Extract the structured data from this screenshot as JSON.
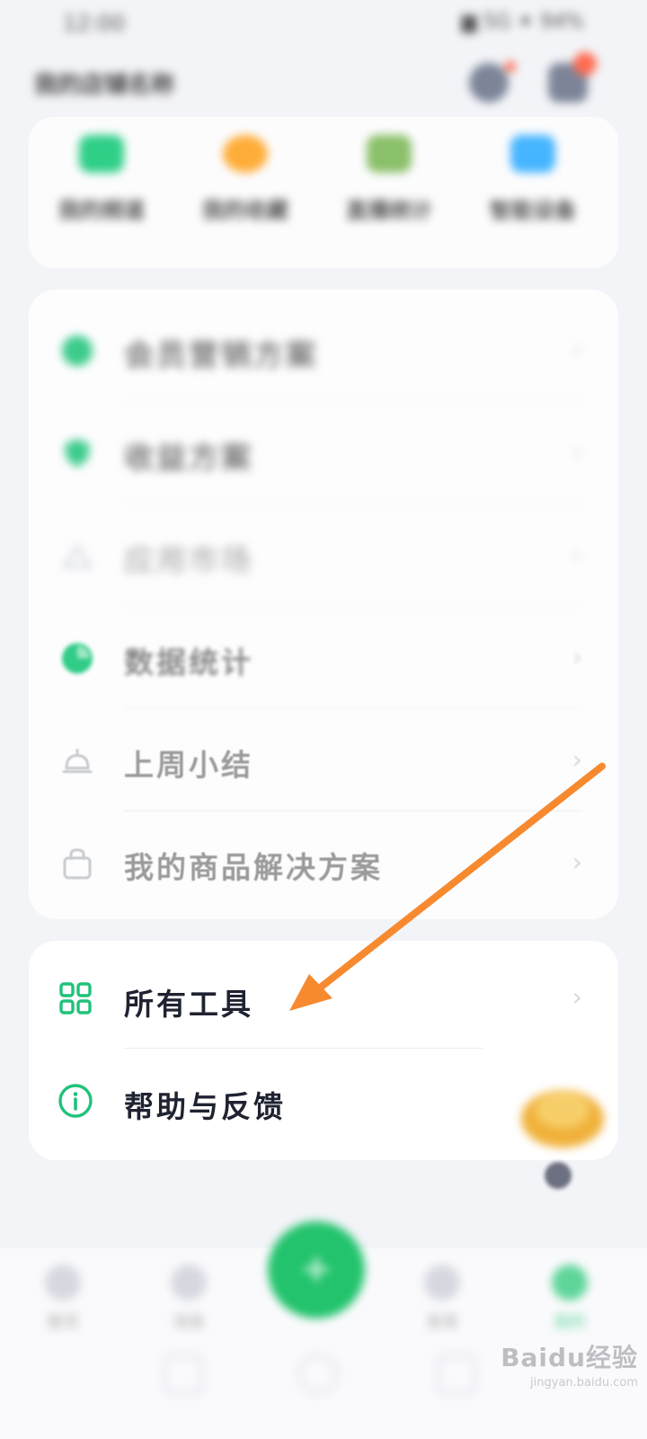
{
  "status_bar": {
    "time": "12:00",
    "right": "▆ 5G ✦ 94%"
  },
  "header": {
    "title": "我的店铺名称"
  },
  "quick_actions": [
    {
      "label": "我的频道",
      "color": "#2fcf88"
    },
    {
      "label": "我的收藏",
      "color": "#ffad39"
    },
    {
      "label": "直播统计",
      "color": "#8ac06a"
    },
    {
      "label": "智能设备",
      "color": "#46b5ff"
    }
  ],
  "menu": {
    "items": [
      {
        "label": "会员营销方案",
        "icon": "leaf-icon",
        "color": "#3ccb8b"
      },
      {
        "label": "收益方案",
        "icon": "shield-icon",
        "color": "#3ccb8b"
      },
      {
        "label": "应用市场",
        "icon": "store-icon",
        "color": "#cfd2d6"
      },
      {
        "label": "数据统计",
        "icon": "chart-icon",
        "color": "#31cc88"
      },
      {
        "label": "上周小结",
        "icon": "bell-icon",
        "color": "#c8cbcf"
      },
      {
        "label": "我的商品解决方案",
        "icon": "bag-icon",
        "color": "#c8cbcf"
      }
    ],
    "chevron": "›"
  },
  "tools": {
    "all_tools": "所有工具",
    "help": "帮助与反馈",
    "accent": "#1fc27a",
    "chevron": "›"
  },
  "annotation": {
    "color": "#f7892f"
  },
  "bottom_nav": {
    "items": [
      "首页",
      "消息",
      "发现",
      "我的"
    ],
    "fab_label": "+",
    "accent": "#22c36c"
  },
  "watermark": {
    "main": "Baidu经验",
    "sub": "jingyan.baidu.com"
  }
}
